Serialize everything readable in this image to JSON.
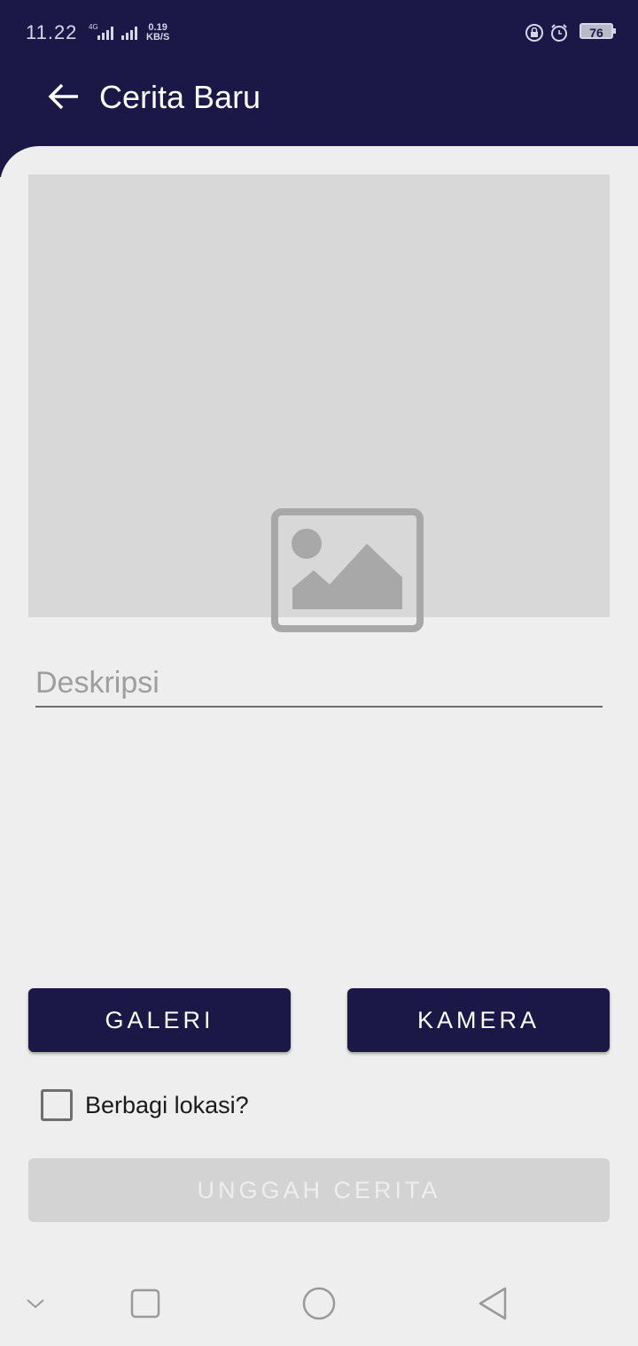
{
  "status_bar": {
    "time": "11.22",
    "network_label": "4G",
    "net_speed_value": "0.19",
    "net_speed_unit": "KB/S",
    "battery": "76",
    "icons": [
      "signal-icon",
      "lock-rotation-icon",
      "alarm-icon",
      "battery-icon"
    ]
  },
  "header": {
    "title": "Cerita Baru",
    "back_icon": "arrow-left-icon",
    "background_color": "#1b1848"
  },
  "image_preview": {
    "icon": "image-placeholder-icon"
  },
  "description": {
    "placeholder": "Deskripsi",
    "value": ""
  },
  "buttons": {
    "galeri": "GALERI",
    "kamera": "KAMERA",
    "upload": "UNGGAH CERITA"
  },
  "location": {
    "label": "Berbagi lokasi?",
    "checked": false
  },
  "nav_bar": {
    "icons": [
      "chevron-down-icon",
      "recents-square-icon",
      "home-circle-icon",
      "back-triangle-icon"
    ]
  },
  "colors": {
    "primary": "#1b1848",
    "disabled": "#d3d3d3",
    "background": "#eeeeee"
  }
}
